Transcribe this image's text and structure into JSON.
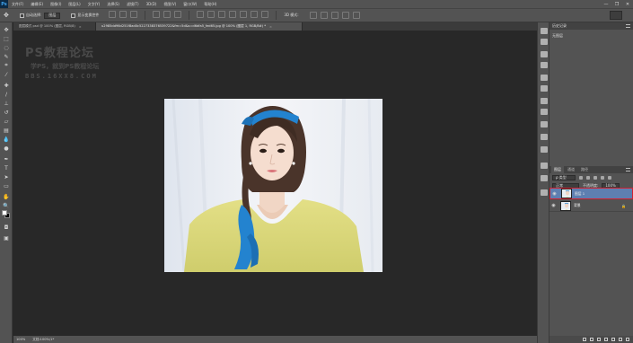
{
  "app": {
    "logo": "Ps",
    "menu": [
      "文件(F)",
      "编辑(E)",
      "图像(I)",
      "图层(L)",
      "文字(Y)",
      "选择(S)",
      "滤镜(T)",
      "3D(D)",
      "视图(V)",
      "窗口(W)",
      "帮助(H)"
    ],
    "window_controls": [
      "—",
      "❐",
      "✕"
    ]
  },
  "options_bar": {
    "auto_select_label": "自动选择:",
    "auto_select_target": "图层",
    "show_transform_label": "显示变换控件",
    "mode_3d_label": "3D 模式:"
  },
  "tabs": [
    {
      "label": "图层模式 psd @ 100% (图层, RGB/8)",
      "close": "×",
      "active": false
    },
    {
      "label": "u2985dd96d251f8ad0c5227338376539722&fm=5d&s=d6dfa5_fed65.jpg @ 100% (图层 1, RGB/8#) *",
      "close": "×",
      "active": true
    }
  ],
  "watermark": {
    "line1": "PS教程论坛",
    "line2": "学PS，就到PS教程论坛",
    "line3": "BBS.16XX8.COM"
  },
  "status": {
    "zoom": "100%",
    "doc_info": "文档:100%/1*"
  },
  "panels": {
    "history_title": "历史记录",
    "history_state": "无图层",
    "layers_tabs": [
      "图层",
      "通道",
      "路径"
    ],
    "kind_label": "ρ 类型",
    "blend_mode": "正常",
    "opacity_label": "不透明度:",
    "opacity_value": "100%",
    "lock_label": "锁定:",
    "fill_label": "填充:",
    "fill_value": "100%",
    "layers": [
      {
        "name": "图层 1",
        "selected": true
      },
      {
        "name": "背景",
        "selected": false
      }
    ]
  },
  "colors": {
    "accent_layer_selected": "#5e7fb0",
    "highlight_border": "#d02030",
    "scarf_blue": "#2383cf",
    "sweater_yellow": "#dbd977"
  }
}
